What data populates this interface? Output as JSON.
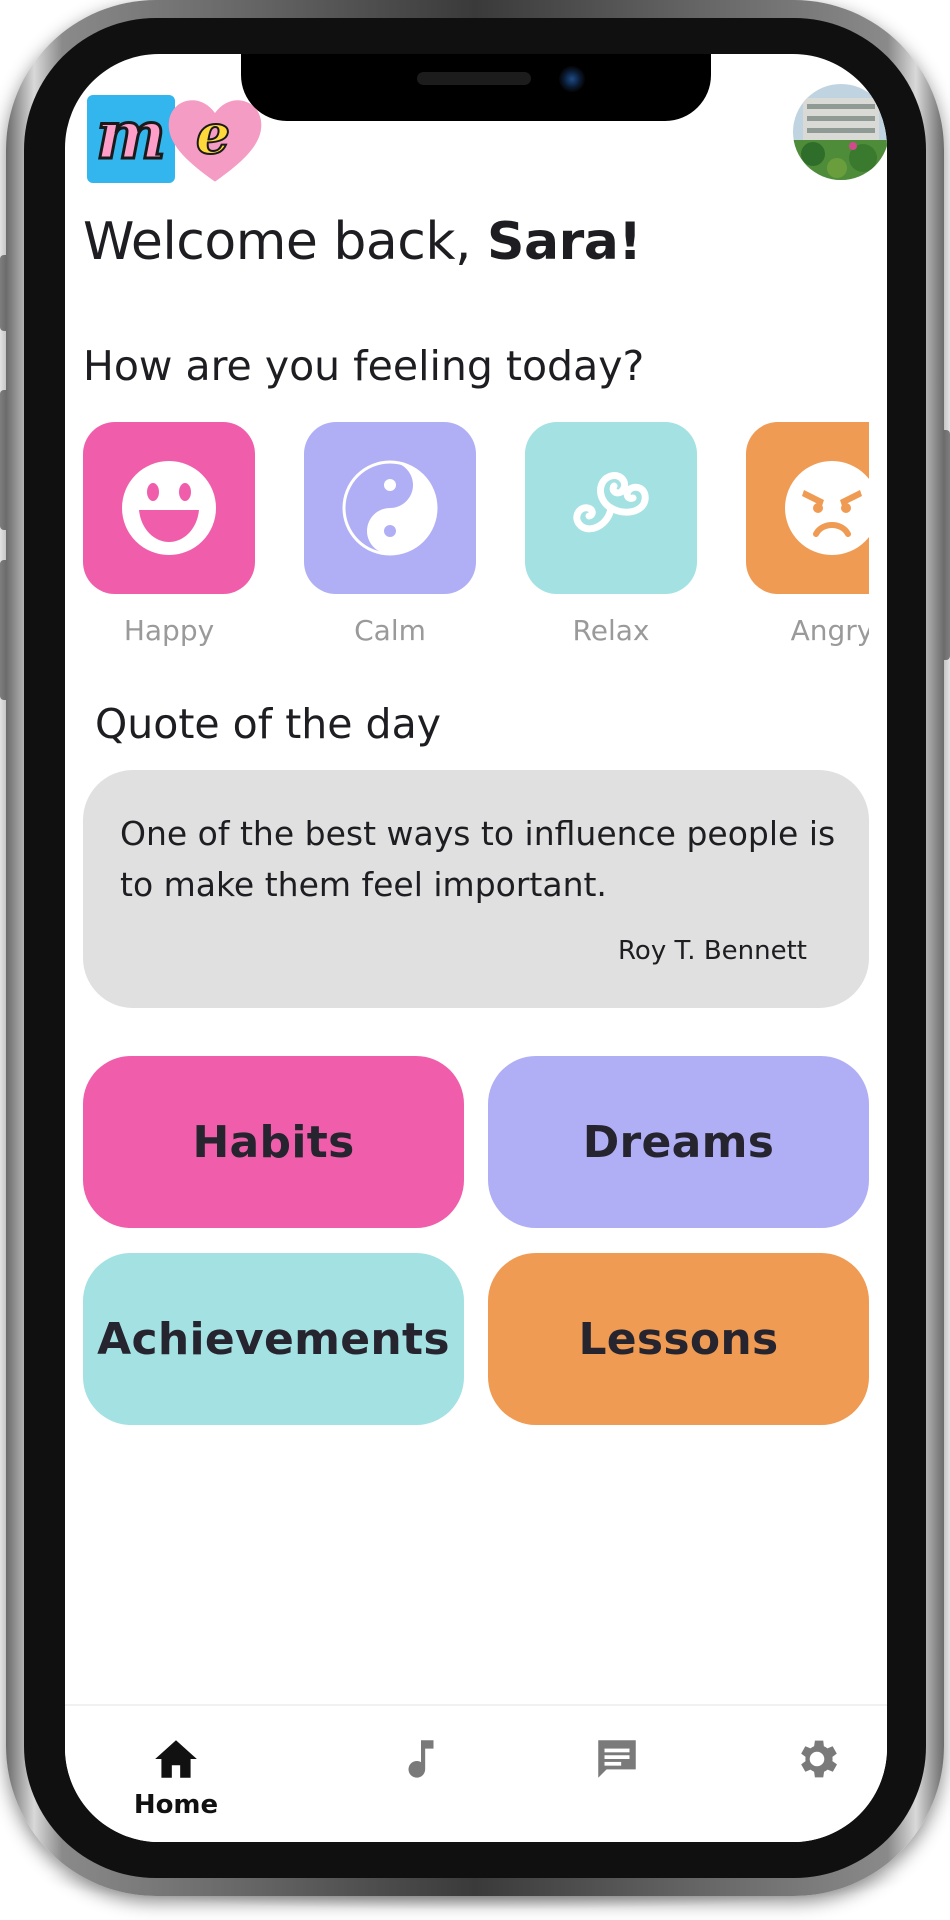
{
  "header": {
    "logo_letters": [
      "m",
      "e"
    ],
    "greeting_prefix": "Welcome back,",
    "user_name": "Sara!"
  },
  "mood_section": {
    "title": "How are you feeling today?",
    "moods": [
      {
        "label": "Happy",
        "color": "#f05eab",
        "icon": "smile-icon"
      },
      {
        "label": "Calm",
        "color": "#b0aff5",
        "icon": "yin-yang-icon"
      },
      {
        "label": "Relax",
        "color": "#a3e1e2",
        "icon": "triskele-icon"
      },
      {
        "label": "Angry",
        "color": "#ef9b53",
        "icon": "angry-face-icon"
      }
    ]
  },
  "quote": {
    "title": "Quote of the day",
    "text": "One of the best ways to influence people is to make them feel important.",
    "author": "Roy T. Bennett"
  },
  "categories": [
    {
      "label": "Habits",
      "color": "#f05eab"
    },
    {
      "label": "Dreams",
      "color": "#b0aff5"
    },
    {
      "label": "Achievements",
      "color": "#a3e1e2"
    },
    {
      "label": "Lessons",
      "color": "#ef9b53"
    }
  ],
  "bottom_nav": {
    "items": [
      {
        "label": "Home",
        "icon": "home-icon",
        "active": true
      },
      {
        "label": "",
        "icon": "music-note-icon",
        "active": false
      },
      {
        "label": "",
        "icon": "chat-icon",
        "active": false
      },
      {
        "label": "",
        "icon": "gear-icon",
        "active": false
      }
    ],
    "active_color": "#111111",
    "inactive_color": "#7a7a7a"
  }
}
